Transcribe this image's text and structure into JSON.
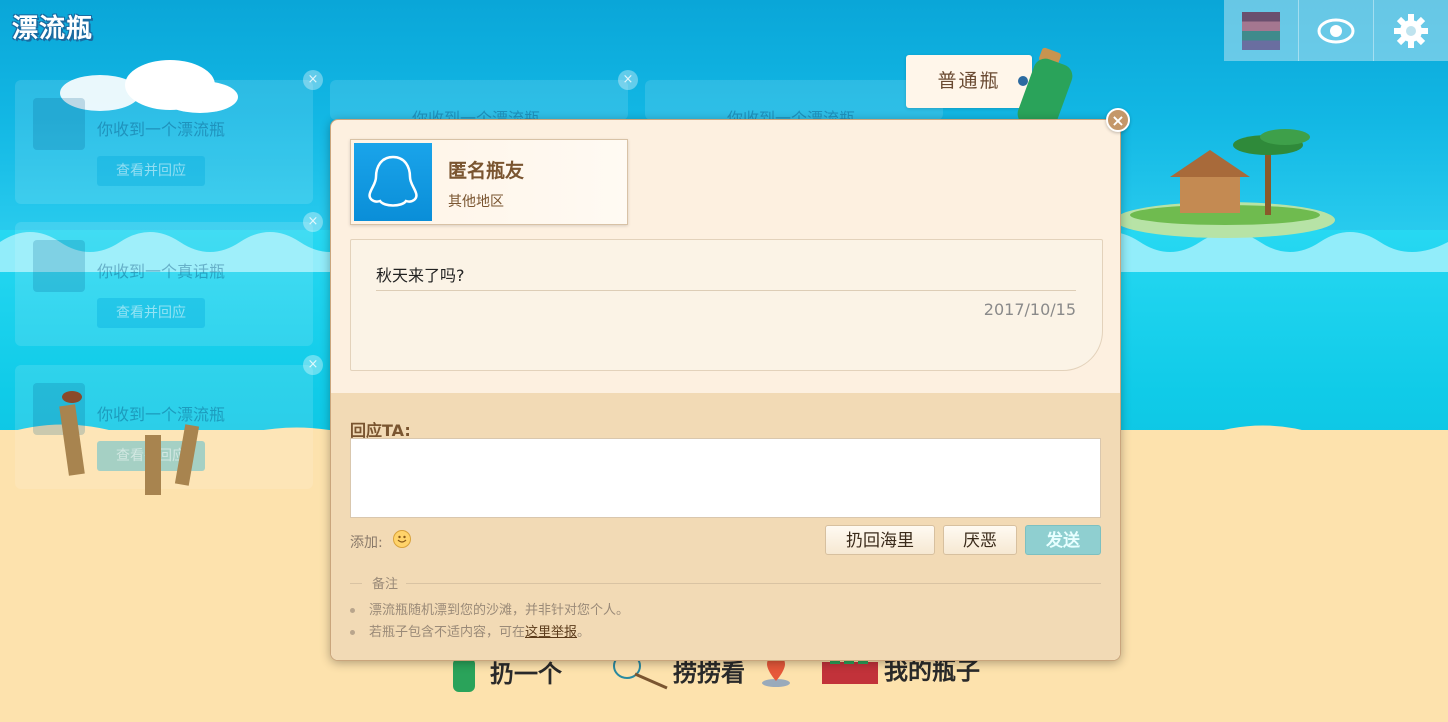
{
  "app": {
    "logo_text": "漂流瓶"
  },
  "colors": {
    "accent": "#1aa4ea",
    "modal_bg": "#fdf0e0",
    "modal_lower_bg": "#f2dab5",
    "send_button": "#8fcfd0",
    "label_brown": "#7a5530"
  },
  "top_right": {
    "icons": [
      "user-avatar-icon",
      "eye-icon",
      "gear-icon"
    ]
  },
  "bottle_tag": {
    "label": "普通瓶"
  },
  "background_cards": [
    {
      "text": "你收到一个漂流瓶",
      "button": "查看并回应"
    },
    {
      "text": "你收到一个真话瓶",
      "button": "查看并回应"
    },
    {
      "text": "你收到一个漂流瓶",
      "button": "查看并回应"
    },
    {
      "text": "你收到一个漂流瓶",
      "button": ""
    },
    {
      "text": "你收到一个漂流瓶",
      "button": ""
    }
  ],
  "bottom_nav": {
    "throw": "扔一个",
    "fish": "捞捞看",
    "my_bottles": "我的瓶子"
  },
  "modal": {
    "close_icon": "close-icon",
    "user": {
      "name": "匿名瓶友",
      "region": "其他地区"
    },
    "message": {
      "text": "秋天来了吗?",
      "date": "2017/10/15"
    },
    "reply": {
      "label": "回应TA:",
      "value": "",
      "placeholder": ""
    },
    "add_label": "添加:",
    "buttons": {
      "throw_back": "扔回海里",
      "dislike": "厌恶",
      "send": "发送"
    },
    "notes": {
      "title": "备注",
      "item1": "漂流瓶随机漂到您的沙滩，并非针对您个人。",
      "item2_prefix": "若瓶子包含不适内容，可在",
      "item2_link": "这里举报",
      "item2_suffix": "。"
    }
  }
}
